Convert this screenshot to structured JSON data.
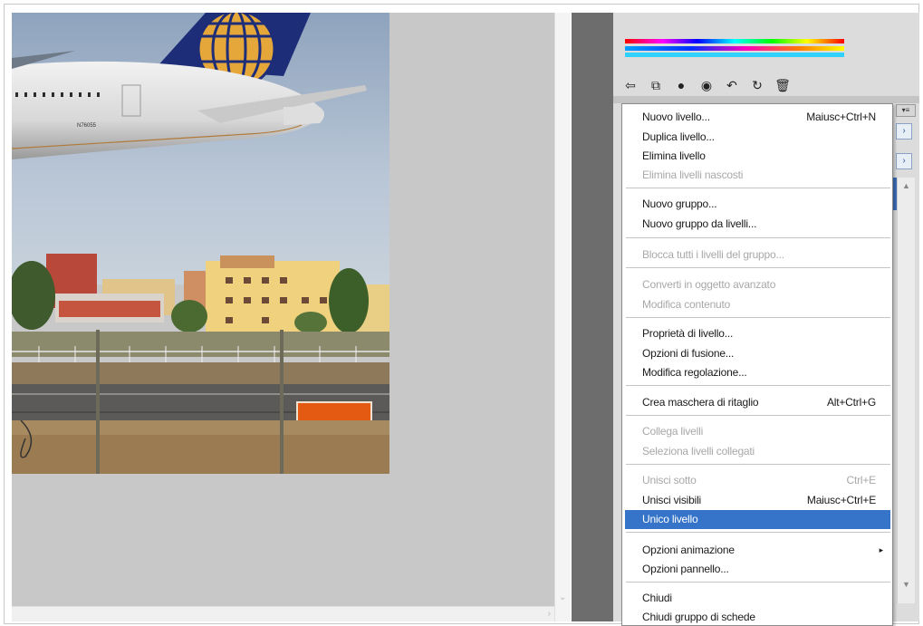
{
  "canvas": {
    "aircraft_registration": "N76055"
  },
  "panel": {
    "tools": [
      {
        "icon": "link-layers-icon",
        "glyph": "⇦"
      },
      {
        "icon": "layer-style-icon",
        "glyph": "⧉"
      },
      {
        "icon": "layer-mask-icon",
        "glyph": "●"
      },
      {
        "icon": "adjustment-layer-icon",
        "glyph": "◉"
      },
      {
        "icon": "new-group-icon",
        "glyph": "↶"
      },
      {
        "icon": "new-layer-icon",
        "glyph": "↻"
      },
      {
        "icon": "delete-layer-icon",
        "glyph": "🗑"
      }
    ],
    "side_arrows": [
      "›",
      "›"
    ],
    "menu_button": "▾≡"
  },
  "menu": {
    "items": [
      {
        "label": "Nuovo livello...",
        "shortcut": "Maiusc+Ctrl+N",
        "disabled": false
      },
      {
        "label": "Duplica livello...",
        "shortcut": "",
        "disabled": false
      },
      {
        "label": "Elimina livello",
        "shortcut": "",
        "disabled": false
      },
      {
        "label": "Elimina livelli nascosti",
        "shortcut": "",
        "disabled": true
      },
      {
        "label": "Nuovo gruppo...",
        "shortcut": "",
        "disabled": false
      },
      {
        "label": "Nuovo gruppo da livelli...",
        "shortcut": "",
        "disabled": false
      },
      {
        "label": "Blocca tutti i livelli del gruppo...",
        "shortcut": "",
        "disabled": true
      },
      {
        "label": "Converti in oggetto avanzato",
        "shortcut": "",
        "disabled": true
      },
      {
        "label": "Modifica contenuto",
        "shortcut": "",
        "disabled": true
      },
      {
        "label": "Proprietà di livello...",
        "shortcut": "",
        "disabled": false
      },
      {
        "label": "Opzioni di fusione...",
        "shortcut": "",
        "disabled": false
      },
      {
        "label": "Modifica regolazione...",
        "shortcut": "",
        "disabled": false
      },
      {
        "label": "Crea maschera di ritaglio",
        "shortcut": "Alt+Ctrl+G",
        "disabled": false
      },
      {
        "label": "Collega livelli",
        "shortcut": "",
        "disabled": true
      },
      {
        "label": "Seleziona livelli collegati",
        "shortcut": "",
        "disabled": true
      },
      {
        "label": "Unisci sotto",
        "shortcut": "Ctrl+E",
        "disabled": true
      },
      {
        "label": "Unisci visibili",
        "shortcut": "Maiusc+Ctrl+E",
        "disabled": false
      },
      {
        "label": "Unico livello",
        "shortcut": "",
        "disabled": false,
        "selected": true
      },
      {
        "label": "Opzioni animazione",
        "shortcut": "",
        "disabled": false,
        "submenu": "▸"
      },
      {
        "label": "Opzioni pannello...",
        "shortcut": "",
        "disabled": false
      },
      {
        "label": "Chiudi",
        "shortcut": "",
        "disabled": false
      },
      {
        "label": "Chiudi gruppo di schede",
        "shortcut": "",
        "disabled": false
      }
    ]
  },
  "colors": {
    "selection": "#3574c8",
    "canvas_bg": "#c8c8c8",
    "panel_bg": "#dcdcdc"
  }
}
